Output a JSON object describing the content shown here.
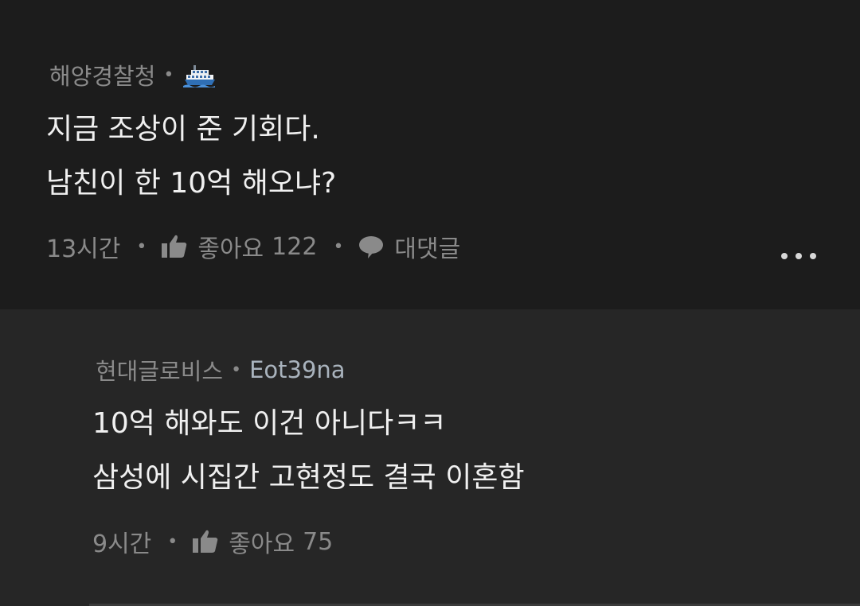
{
  "comments": [
    {
      "author": "해양경찰청",
      "separator": "•",
      "author_icon": "ship-icon",
      "lines": [
        "지금 조상이 준 기회다.",
        "남친이 한 10억 해오냐?"
      ],
      "time": "13시간",
      "like_label": "좋아요",
      "like_count": "122",
      "reply_label": "대댓글",
      "has_more_menu": true
    },
    {
      "author": "현대글로비스",
      "separator": "•",
      "author_tag": "Eot39na",
      "lines": [
        "10억 해와도 이건 아니다ㅋㅋ",
        "삼성에 시집간 고현정도 결국 이혼함"
      ],
      "time": "9시간",
      "like_label": "좋아요",
      "like_count": "75"
    }
  ],
  "colors": {
    "background_top": "#1c1c1c",
    "background_reply": "#262626",
    "text_primary": "#f0f0f0",
    "text_secondary": "#8a8a8a",
    "tag_color": "#a9b3bd"
  }
}
